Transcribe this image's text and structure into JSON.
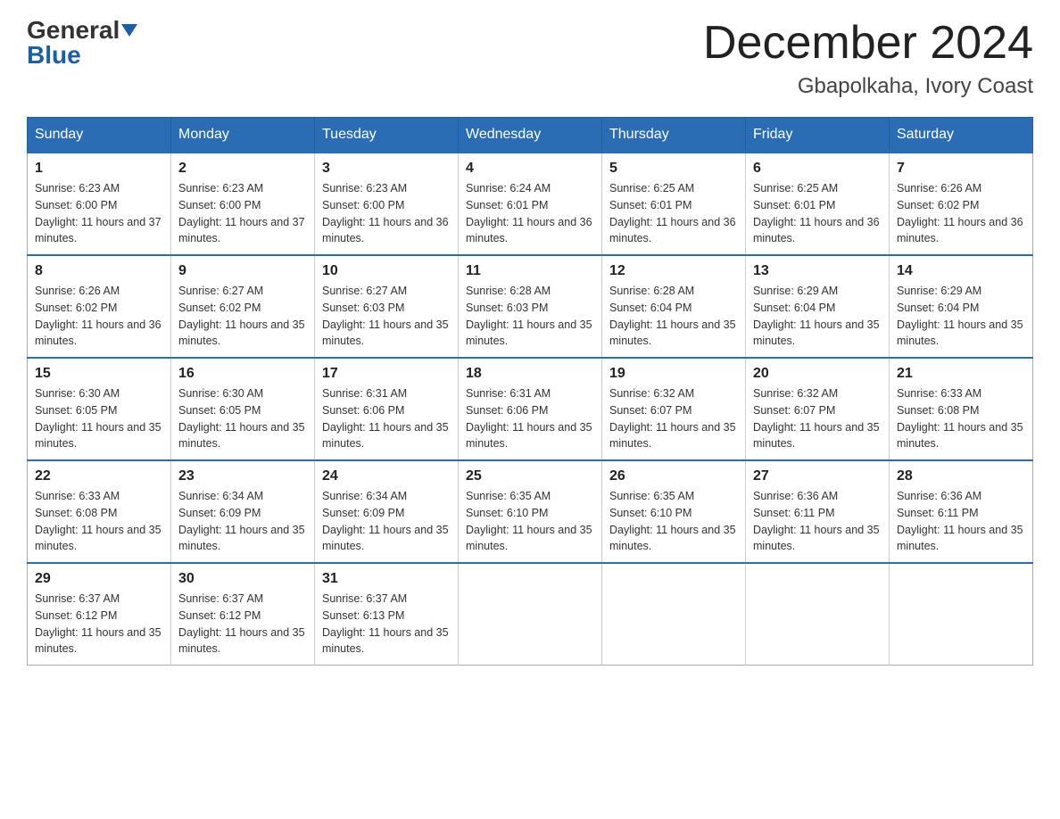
{
  "header": {
    "logo_general": "General",
    "logo_blue": "Blue",
    "month_title": "December 2024",
    "location": "Gbapolkaha, Ivory Coast"
  },
  "weekdays": [
    "Sunday",
    "Monday",
    "Tuesday",
    "Wednesday",
    "Thursday",
    "Friday",
    "Saturday"
  ],
  "weeks": [
    [
      {
        "day": "1",
        "sunrise": "6:23 AM",
        "sunset": "6:00 PM",
        "daylight": "11 hours and 37 minutes."
      },
      {
        "day": "2",
        "sunrise": "6:23 AM",
        "sunset": "6:00 PM",
        "daylight": "11 hours and 37 minutes."
      },
      {
        "day": "3",
        "sunrise": "6:23 AM",
        "sunset": "6:00 PM",
        "daylight": "11 hours and 36 minutes."
      },
      {
        "day": "4",
        "sunrise": "6:24 AM",
        "sunset": "6:01 PM",
        "daylight": "11 hours and 36 minutes."
      },
      {
        "day": "5",
        "sunrise": "6:25 AM",
        "sunset": "6:01 PM",
        "daylight": "11 hours and 36 minutes."
      },
      {
        "day": "6",
        "sunrise": "6:25 AM",
        "sunset": "6:01 PM",
        "daylight": "11 hours and 36 minutes."
      },
      {
        "day": "7",
        "sunrise": "6:26 AM",
        "sunset": "6:02 PM",
        "daylight": "11 hours and 36 minutes."
      }
    ],
    [
      {
        "day": "8",
        "sunrise": "6:26 AM",
        "sunset": "6:02 PM",
        "daylight": "11 hours and 36 minutes."
      },
      {
        "day": "9",
        "sunrise": "6:27 AM",
        "sunset": "6:02 PM",
        "daylight": "11 hours and 35 minutes."
      },
      {
        "day": "10",
        "sunrise": "6:27 AM",
        "sunset": "6:03 PM",
        "daylight": "11 hours and 35 minutes."
      },
      {
        "day": "11",
        "sunrise": "6:28 AM",
        "sunset": "6:03 PM",
        "daylight": "11 hours and 35 minutes."
      },
      {
        "day": "12",
        "sunrise": "6:28 AM",
        "sunset": "6:04 PM",
        "daylight": "11 hours and 35 minutes."
      },
      {
        "day": "13",
        "sunrise": "6:29 AM",
        "sunset": "6:04 PM",
        "daylight": "11 hours and 35 minutes."
      },
      {
        "day": "14",
        "sunrise": "6:29 AM",
        "sunset": "6:04 PM",
        "daylight": "11 hours and 35 minutes."
      }
    ],
    [
      {
        "day": "15",
        "sunrise": "6:30 AM",
        "sunset": "6:05 PM",
        "daylight": "11 hours and 35 minutes."
      },
      {
        "day": "16",
        "sunrise": "6:30 AM",
        "sunset": "6:05 PM",
        "daylight": "11 hours and 35 minutes."
      },
      {
        "day": "17",
        "sunrise": "6:31 AM",
        "sunset": "6:06 PM",
        "daylight": "11 hours and 35 minutes."
      },
      {
        "day": "18",
        "sunrise": "6:31 AM",
        "sunset": "6:06 PM",
        "daylight": "11 hours and 35 minutes."
      },
      {
        "day": "19",
        "sunrise": "6:32 AM",
        "sunset": "6:07 PM",
        "daylight": "11 hours and 35 minutes."
      },
      {
        "day": "20",
        "sunrise": "6:32 AM",
        "sunset": "6:07 PM",
        "daylight": "11 hours and 35 minutes."
      },
      {
        "day": "21",
        "sunrise": "6:33 AM",
        "sunset": "6:08 PM",
        "daylight": "11 hours and 35 minutes."
      }
    ],
    [
      {
        "day": "22",
        "sunrise": "6:33 AM",
        "sunset": "6:08 PM",
        "daylight": "11 hours and 35 minutes."
      },
      {
        "day": "23",
        "sunrise": "6:34 AM",
        "sunset": "6:09 PM",
        "daylight": "11 hours and 35 minutes."
      },
      {
        "day": "24",
        "sunrise": "6:34 AM",
        "sunset": "6:09 PM",
        "daylight": "11 hours and 35 minutes."
      },
      {
        "day": "25",
        "sunrise": "6:35 AM",
        "sunset": "6:10 PM",
        "daylight": "11 hours and 35 minutes."
      },
      {
        "day": "26",
        "sunrise": "6:35 AM",
        "sunset": "6:10 PM",
        "daylight": "11 hours and 35 minutes."
      },
      {
        "day": "27",
        "sunrise": "6:36 AM",
        "sunset": "6:11 PM",
        "daylight": "11 hours and 35 minutes."
      },
      {
        "day": "28",
        "sunrise": "6:36 AM",
        "sunset": "6:11 PM",
        "daylight": "11 hours and 35 minutes."
      }
    ],
    [
      {
        "day": "29",
        "sunrise": "6:37 AM",
        "sunset": "6:12 PM",
        "daylight": "11 hours and 35 minutes."
      },
      {
        "day": "30",
        "sunrise": "6:37 AM",
        "sunset": "6:12 PM",
        "daylight": "11 hours and 35 minutes."
      },
      {
        "day": "31",
        "sunrise": "6:37 AM",
        "sunset": "6:13 PM",
        "daylight": "11 hours and 35 minutes."
      },
      null,
      null,
      null,
      null
    ]
  ]
}
